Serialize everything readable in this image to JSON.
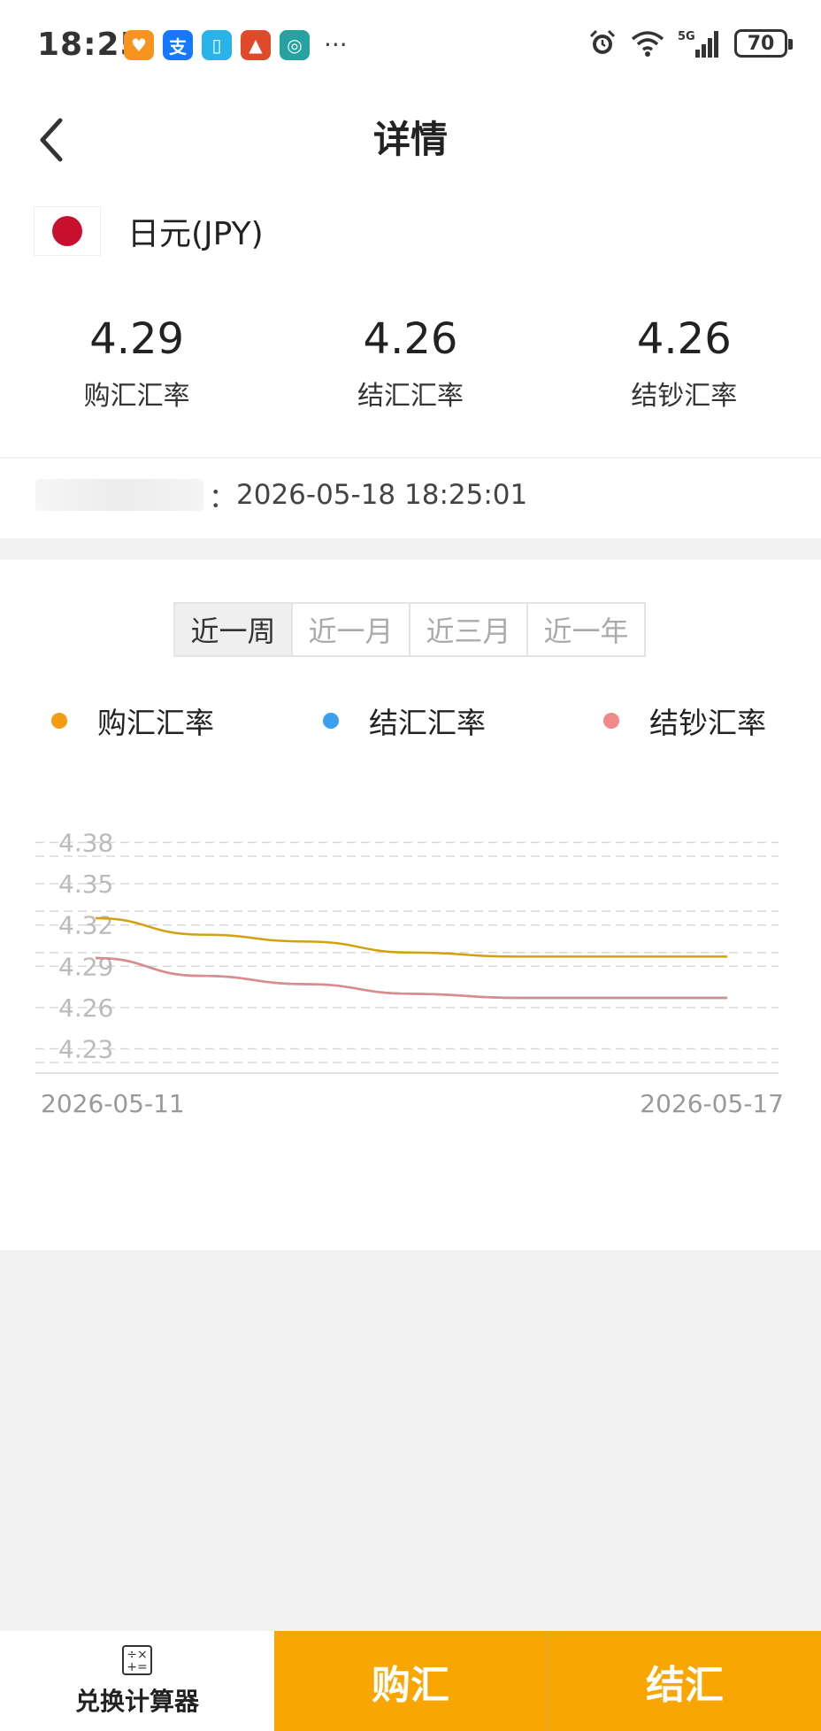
{
  "status_bar": {
    "time": "18:25",
    "more": "···",
    "battery": "70",
    "network": "5G",
    "app_icons": [
      {
        "name": "app-heart-icon",
        "color": "#f7931e",
        "glyph": "♥"
      },
      {
        "name": "alipay-icon",
        "color": "#1677ff",
        "glyph": "支"
      },
      {
        "name": "book-icon",
        "color": "#28b4e8",
        "glyph": "▯"
      },
      {
        "name": "train-icon",
        "color": "#e04a2b",
        "glyph": "▲"
      },
      {
        "name": "china-mobile-icon",
        "color": "#26a3a0",
        "glyph": "◎"
      }
    ]
  },
  "header": {
    "title": "详情",
    "back_icon": "chevron-left-icon"
  },
  "currency": {
    "name": "日元(JPY)",
    "flag": "japan-flag-icon"
  },
  "rates": [
    {
      "value": "4.29",
      "label": "购汇汇率"
    },
    {
      "value": "4.26",
      "label": "结汇汇率"
    },
    {
      "value": "4.26",
      "label": "结钞汇率"
    }
  ],
  "update": {
    "sep": "：",
    "time": "2026-05-18 18:25:01"
  },
  "tabs": [
    {
      "label": "近一周",
      "active": true
    },
    {
      "label": "近一月",
      "active": false
    },
    {
      "label": "近三月",
      "active": false
    },
    {
      "label": "近一年",
      "active": false
    }
  ],
  "legend": [
    {
      "label": "购汇汇率",
      "color": "#f39c12"
    },
    {
      "label": "结汇汇率",
      "color": "#3a9ff0"
    },
    {
      "label": "结钞汇率",
      "color": "#f08a88"
    }
  ],
  "chart_data": {
    "type": "line",
    "x_labels": [
      "2026-05-11",
      "2026-05-17"
    ],
    "x": [
      "2026-05-11",
      "2026-05-12",
      "2026-05-13",
      "2026-05-14",
      "2026-05-15",
      "2026-05-16",
      "2026-05-17"
    ],
    "y_ticks": [
      "4.38",
      "4.35",
      "4.32",
      "4.29",
      "4.26",
      "4.23"
    ],
    "ylim": [
      4.22,
      4.39
    ],
    "grid": true,
    "series": [
      {
        "name": "购汇汇率",
        "color": "#d4a010",
        "values": [
          4.325,
          4.313,
          4.308,
          4.3,
          4.297,
          4.297,
          4.297
        ]
      },
      {
        "name": "结汇汇率",
        "color": "#3a9ff0",
        "values": [
          4.296,
          4.283,
          4.277,
          4.27,
          4.267,
          4.267,
          4.267
        ]
      },
      {
        "name": "结钞汇率",
        "color": "#e08a88",
        "values": [
          4.296,
          4.283,
          4.277,
          4.27,
          4.267,
          4.267,
          4.267
        ]
      }
    ]
  },
  "bottom": {
    "calc_label": "兑换计算器",
    "buy_label": "购汇",
    "sell_label": "结汇"
  }
}
